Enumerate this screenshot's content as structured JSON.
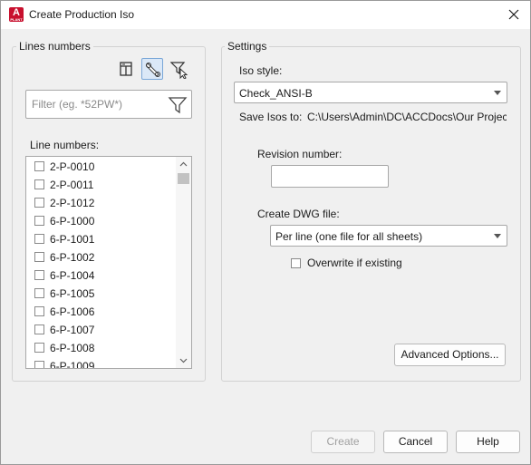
{
  "window": {
    "title": "Create Production Iso"
  },
  "left_panel": {
    "group_label": "Lines numbers",
    "filter_placeholder": "Filter (eg. *52PW*)",
    "list_label": "Line numbers:",
    "items": [
      {
        "label": "2-P-0010",
        "checked": false
      },
      {
        "label": "2-P-0011",
        "checked": false
      },
      {
        "label": "2-P-1012",
        "checked": false
      },
      {
        "label": "6-P-1000",
        "checked": false
      },
      {
        "label": "6-P-1001",
        "checked": false
      },
      {
        "label": "6-P-1002",
        "checked": false
      },
      {
        "label": "6-P-1004",
        "checked": false
      },
      {
        "label": "6-P-1005",
        "checked": false
      },
      {
        "label": "6-P-1006",
        "checked": false
      },
      {
        "label": "6-P-1007",
        "checked": false
      },
      {
        "label": "6-P-1008",
        "checked": false
      },
      {
        "label": "6-P-1009",
        "checked": false
      }
    ]
  },
  "settings": {
    "group_label": "Settings",
    "iso_style_label": "Iso style:",
    "iso_style_value": "Check_ANSI-B",
    "save_isos_label": "Save Isos to:",
    "save_isos_path": "C:\\Users\\Admin\\DC\\ACCDocs\\Our Projec",
    "revision_label": "Revision number:",
    "revision_value": "",
    "create_dwg_label": "Create DWG file:",
    "create_dwg_value": "Per line (one file for all sheets)",
    "overwrite_label": "Overwrite if existing",
    "overwrite_checked": false,
    "advanced_button": "Advanced Options..."
  },
  "footer": {
    "create_button": "Create",
    "cancel_button": "Cancel",
    "help_button": "Help"
  },
  "colors": {
    "app_icon": "#c8102e",
    "active_tool": "#dbe8f7"
  },
  "icons": [
    "autocad-app-icon",
    "close-icon",
    "iso-sheet-icon",
    "pipe-select-icon",
    "filter-select-icon",
    "filter-icon",
    "scroll-up-icon",
    "scroll-down-icon",
    "chevron-down-icon"
  ]
}
